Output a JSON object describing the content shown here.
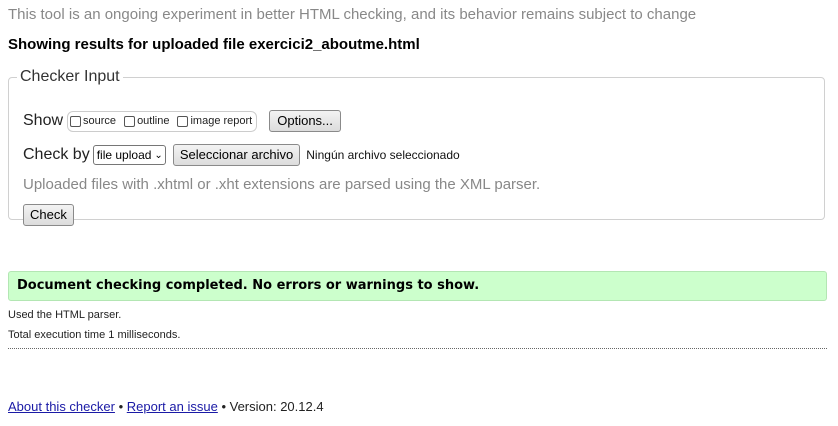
{
  "notice": "This tool is an ongoing experiment in better HTML checking, and its behavior remains subject to change",
  "results_heading": "Showing results for uploaded file exercici2_aboutme.html",
  "checker_input": {
    "legend": "Checker Input",
    "show_label": "Show",
    "show_options": [
      {
        "label": "source",
        "checked": false
      },
      {
        "label": "outline",
        "checked": false
      },
      {
        "label": "image report",
        "checked": false
      }
    ],
    "options_button": "Options...",
    "check_by_label": "Check by",
    "check_by_selected": "file upload",
    "file_button": "Seleccionar archivo",
    "no_file_text": "Ningún archivo seleccionado",
    "hint": "Uploaded files with .xhtml or .xht extensions are parsed using the XML parser.",
    "check_button": "Check"
  },
  "result": {
    "success_message": "Document checking completed. No errors or warnings to show.",
    "parser_line": "Used the HTML parser.",
    "time_line": "Total execution time 1 milliseconds."
  },
  "footer": {
    "about_link": "About this checker",
    "separator": "•",
    "report_link": "Report an issue",
    "version": "• Version: 20.12.4"
  },
  "colors": {
    "success_bg": "#ccffcc",
    "link": "#1a1aa6",
    "muted_text": "#888888"
  }
}
